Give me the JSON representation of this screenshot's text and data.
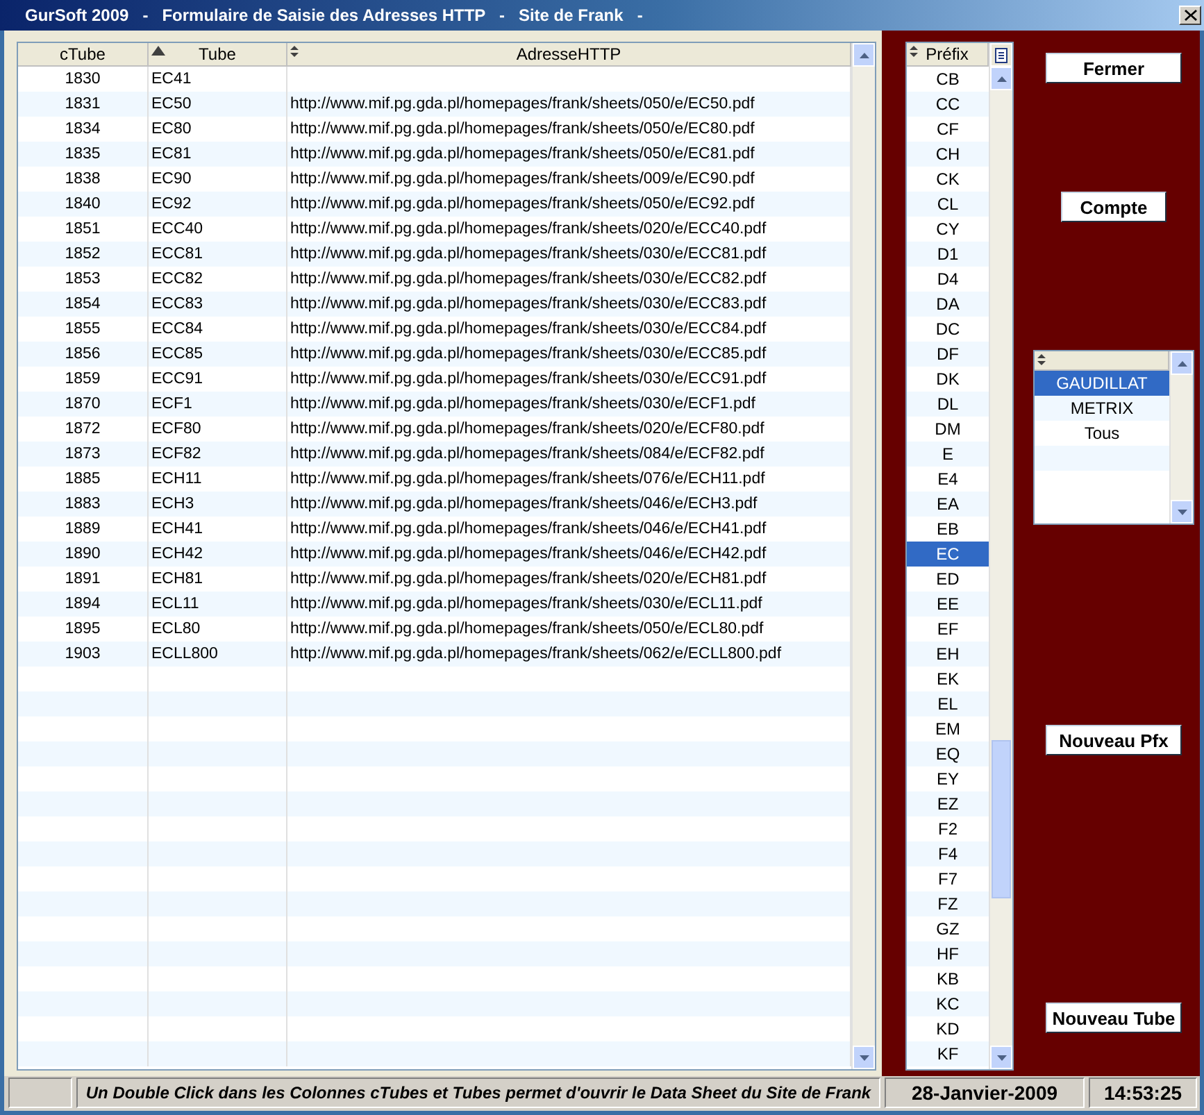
{
  "window": {
    "title": "GurSoft 2009   -   Formulaire de Saisie des Adresses HTTP   -   Site de Frank   -"
  },
  "table": {
    "columns": [
      {
        "label": "cTube",
        "kind": "plain"
      },
      {
        "label": "Tube",
        "kind": "sorted"
      },
      {
        "label": "AdresseHTTP",
        "kind": "sortable"
      }
    ],
    "rows": [
      {
        "ctube": "1830",
        "tube": "EC41"
      },
      {
        "ctube": "1831",
        "tube": "EC50",
        "adresse": "http://www.mif.pg.gda.pl/homepages/frank/sheets/050/e/EC50.pdf"
      },
      {
        "ctube": "1834",
        "tube": "EC80",
        "adresse": "http://www.mif.pg.gda.pl/homepages/frank/sheets/050/e/EC80.pdf"
      },
      {
        "ctube": "1835",
        "tube": "EC81",
        "adresse": "http://www.mif.pg.gda.pl/homepages/frank/sheets/050/e/EC81.pdf"
      },
      {
        "ctube": "1838",
        "tube": "EC90",
        "adresse": "http://www.mif.pg.gda.pl/homepages/frank/sheets/009/e/EC90.pdf"
      },
      {
        "ctube": "1840",
        "tube": "EC92",
        "adresse": "http://www.mif.pg.gda.pl/homepages/frank/sheets/050/e/EC92.pdf"
      },
      {
        "ctube": "1851",
        "tube": "ECC40",
        "adresse": "http://www.mif.pg.gda.pl/homepages/frank/sheets/020/e/ECC40.pdf"
      },
      {
        "ctube": "1852",
        "tube": "ECC81",
        "adresse": "http://www.mif.pg.gda.pl/homepages/frank/sheets/030/e/ECC81.pdf"
      },
      {
        "ctube": "1853",
        "tube": "ECC82",
        "adresse": "http://www.mif.pg.gda.pl/homepages/frank/sheets/030/e/ECC82.pdf"
      },
      {
        "ctube": "1854",
        "tube": "ECC83",
        "adresse": "http://www.mif.pg.gda.pl/homepages/frank/sheets/030/e/ECC83.pdf"
      },
      {
        "ctube": "1855",
        "tube": "ECC84",
        "adresse": "http://www.mif.pg.gda.pl/homepages/frank/sheets/030/e/ECC84.pdf"
      },
      {
        "ctube": "1856",
        "tube": "ECC85",
        "adresse": "http://www.mif.pg.gda.pl/homepages/frank/sheets/030/e/ECC85.pdf"
      },
      {
        "ctube": "1859",
        "tube": "ECC91",
        "adresse": "http://www.mif.pg.gda.pl/homepages/frank/sheets/030/e/ECC91.pdf"
      },
      {
        "ctube": "1870",
        "tube": "ECF1",
        "adresse": "http://www.mif.pg.gda.pl/homepages/frank/sheets/030/e/ECF1.pdf"
      },
      {
        "ctube": "1872",
        "tube": "ECF80",
        "adresse": "http://www.mif.pg.gda.pl/homepages/frank/sheets/020/e/ECF80.pdf"
      },
      {
        "ctube": "1873",
        "tube": "ECF82",
        "adresse": "http://www.mif.pg.gda.pl/homepages/frank/sheets/084/e/ECF82.pdf"
      },
      {
        "ctube": "1885",
        "tube": "ECH11",
        "adresse": "http://www.mif.pg.gda.pl/homepages/frank/sheets/076/e/ECH11.pdf"
      },
      {
        "ctube": "1883",
        "tube": "ECH3",
        "adresse": "http://www.mif.pg.gda.pl/homepages/frank/sheets/046/e/ECH3.pdf"
      },
      {
        "ctube": "1889",
        "tube": "ECH41",
        "adresse": "http://www.mif.pg.gda.pl/homepages/frank/sheets/046/e/ECH41.pdf"
      },
      {
        "ctube": "1890",
        "tube": "ECH42",
        "adresse": "http://www.mif.pg.gda.pl/homepages/frank/sheets/046/e/ECH42.pdf"
      },
      {
        "ctube": "1891",
        "tube": "ECH81",
        "adresse": "http://www.mif.pg.gda.pl/homepages/frank/sheets/020/e/ECH81.pdf"
      },
      {
        "ctube": "1894",
        "tube": "ECL11",
        "adresse": "http://www.mif.pg.gda.pl/homepages/frank/sheets/030/e/ECL11.pdf"
      },
      {
        "ctube": "1895",
        "tube": "ECL80",
        "adresse": "http://www.mif.pg.gda.pl/homepages/frank/sheets/050/e/ECL80.pdf"
      },
      {
        "ctube": "1903",
        "tube": "ECLL800",
        "adresse": "http://www.mif.pg.gda.pl/homepages/frank/sheets/062/e/ECLL800.pdf"
      }
    ]
  },
  "prefix_list": {
    "header": {
      "label": "Préfix",
      "kind": "sortable"
    },
    "items": [
      {
        "label": "CB",
        "selected": false
      },
      {
        "label": "CC",
        "selected": false
      },
      {
        "label": "CF",
        "selected": false
      },
      {
        "label": "CH",
        "selected": false
      },
      {
        "label": "CK",
        "selected": false
      },
      {
        "label": "CL",
        "selected": false
      },
      {
        "label": "CY",
        "selected": false
      },
      {
        "label": "D1",
        "selected": false
      },
      {
        "label": "D4",
        "selected": false
      },
      {
        "label": "DA",
        "selected": false
      },
      {
        "label": "DC",
        "selected": false
      },
      {
        "label": "DF",
        "selected": false
      },
      {
        "label": "DK",
        "selected": false
      },
      {
        "label": "DL",
        "selected": false
      },
      {
        "label": "DM",
        "selected": false
      },
      {
        "label": "E",
        "selected": false
      },
      {
        "label": "E4",
        "selected": false
      },
      {
        "label": "EA",
        "selected": false
      },
      {
        "label": "EB",
        "selected": false
      },
      {
        "label": "EC",
        "selected": true
      },
      {
        "label": "ED",
        "selected": false
      },
      {
        "label": "EE",
        "selected": false
      },
      {
        "label": "EF",
        "selected": false
      },
      {
        "label": "EH",
        "selected": false
      },
      {
        "label": "EK",
        "selected": false
      },
      {
        "label": "EL",
        "selected": false
      },
      {
        "label": "EM",
        "selected": false
      },
      {
        "label": "EQ",
        "selected": false
      },
      {
        "label": "EY",
        "selected": false
      },
      {
        "label": "EZ",
        "selected": false
      },
      {
        "label": "F2",
        "selected": false
      },
      {
        "label": "F4",
        "selected": false
      },
      {
        "label": "F7",
        "selected": false
      },
      {
        "label": "FZ",
        "selected": false
      },
      {
        "label": "GZ",
        "selected": false
      },
      {
        "label": "HF",
        "selected": false
      },
      {
        "label": "KB",
        "selected": false
      },
      {
        "label": "KC",
        "selected": false
      },
      {
        "label": "KD",
        "selected": false
      },
      {
        "label": "KF",
        "selected": false
      }
    ]
  },
  "buttons": {
    "close": "Fermer",
    "count": "Compte",
    "new_prefix": "Nouveau Pfx",
    "new_tube": "Nouveau Tube"
  },
  "source_list": {
    "header": {
      "kind": "sortable"
    },
    "items": [
      {
        "label": "GAUDILLAT",
        "selected": true
      },
      {
        "label": "METRIX",
        "selected": false
      },
      {
        "label": "Tous",
        "selected": false
      }
    ]
  },
  "status_bar": {
    "message": "Un Double Click dans les Colonnes cTubes et Tubes permet d'ouvrir le Data Sheet du Site de Frank",
    "date": "28-Janvier-2009",
    "time": "14:53:25"
  }
}
